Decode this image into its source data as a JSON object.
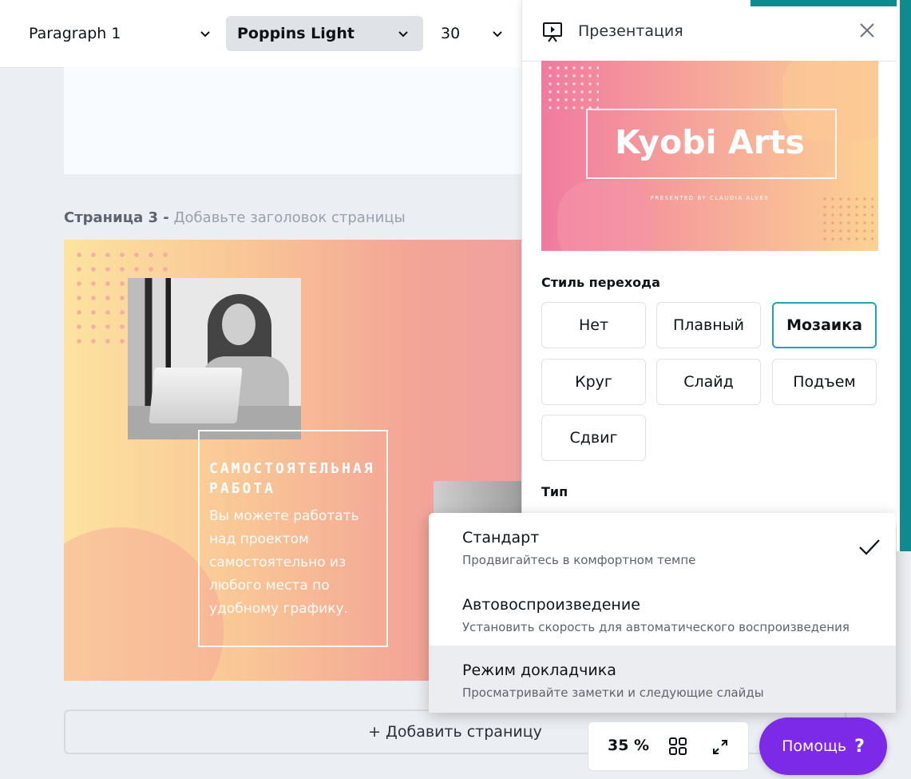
{
  "toolbar": {
    "paragraph_style": "Paragraph 1",
    "font_family": "Poppins Light",
    "font_size": "30"
  },
  "canvas": {
    "page_label_prefix": "Страница 3 -",
    "page_label_placeholder": "Добавьте заголовок страницы",
    "slide": {
      "title": "САМОСТОЯТЕЛЬНАЯ РАБОТА",
      "body": "Вы можете работать над проектом самостоятельно из любого места по удобному графику."
    },
    "add_page_label": "+ Добавить страницу"
  },
  "panel": {
    "title": "Презентация",
    "preview": {
      "title": "Kyobi Arts",
      "subtitle": "PRESENTED BY CLAUDIA ALVES"
    },
    "transition_label": "Стиль перехода",
    "transitions": [
      "Нет",
      "Плавный",
      "Мозаика",
      "Круг",
      "Слайд",
      "Подъем",
      "Сдвиг"
    ],
    "selected_transition": "Мозаика",
    "type_label": "Тип"
  },
  "type_menu": {
    "items": [
      {
        "title": "Стандарт",
        "desc": "Продвигайтесь в комфортном темпе",
        "checked": true
      },
      {
        "title": "Автовоспроизведение",
        "desc": "Установить скорость для автоматического воспроизведения",
        "checked": false
      },
      {
        "title": "Режим докладчика",
        "desc": "Просматривайте заметки и следующие слайды",
        "checked": false
      }
    ]
  },
  "footer": {
    "zoom": "35 %",
    "help_label": "Помощь",
    "help_mark": "?"
  },
  "colors": {
    "accent": "#7d2ae8",
    "selected_border": "#1ea3b8",
    "edge_strip": "#0f8a8f"
  },
  "icons": [
    "chevron-down-icon",
    "presentation-icon",
    "close-icon",
    "check-icon",
    "grid-icon",
    "expand-icon"
  ]
}
